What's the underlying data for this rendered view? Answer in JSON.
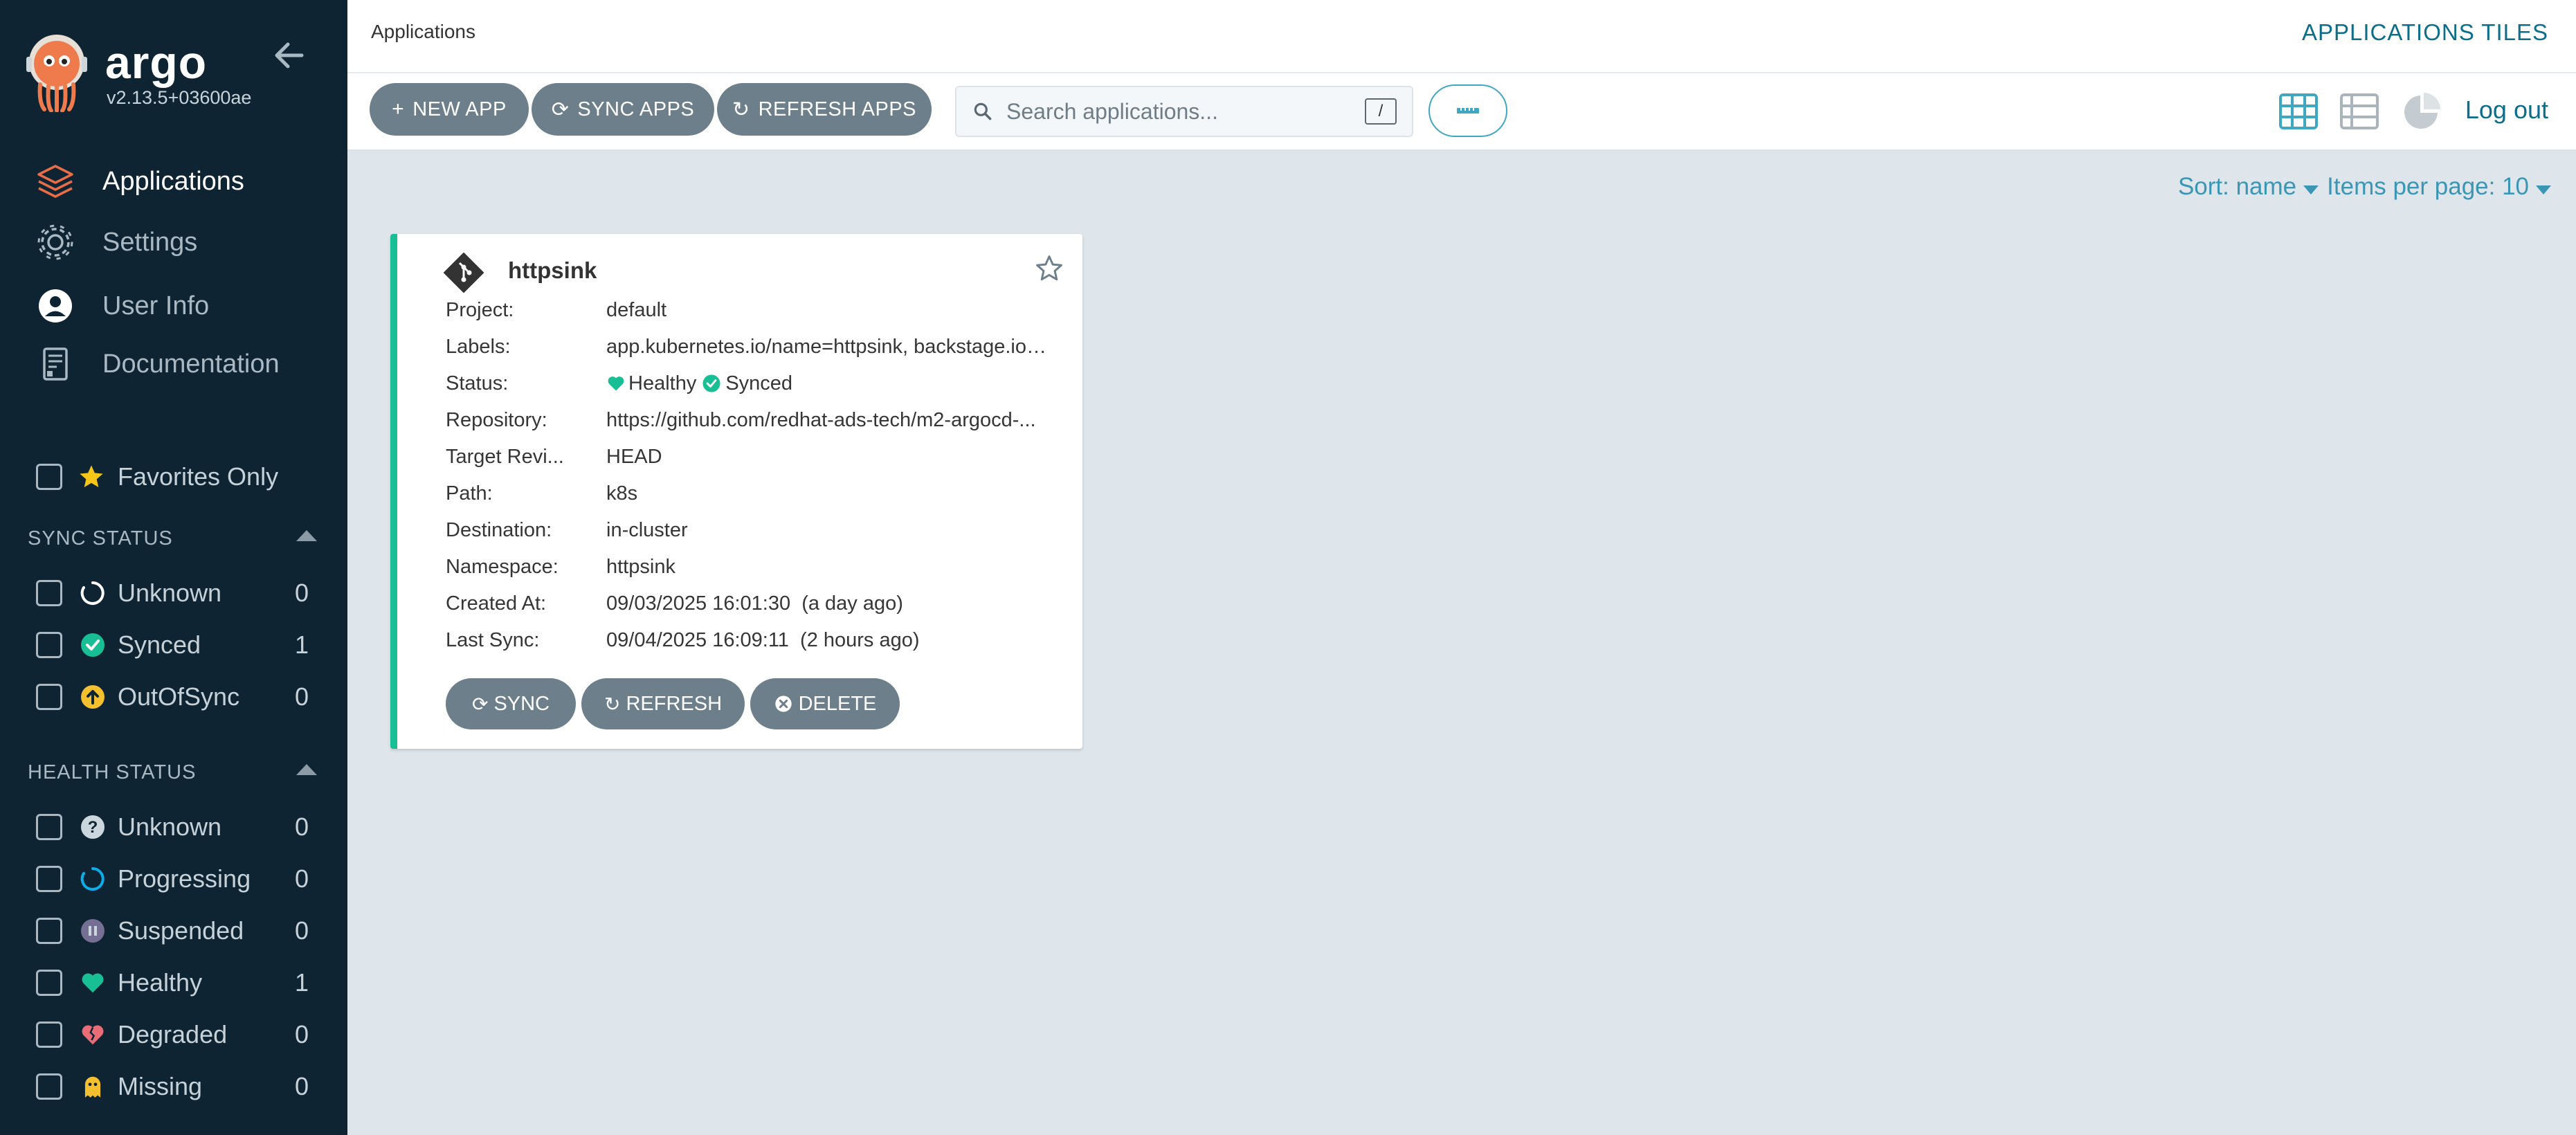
{
  "sidebar": {
    "brand": "argo",
    "version": "v2.13.5+03600ae",
    "nav": [
      {
        "label": "Applications",
        "icon": "layers-icon",
        "active": true
      },
      {
        "label": "Settings",
        "icon": "gear-icon"
      },
      {
        "label": "User Info",
        "icon": "user-icon"
      },
      {
        "label": "Documentation",
        "icon": "docs-icon"
      }
    ],
    "favorites_label": "Favorites Only",
    "sync_status": {
      "title": "SYNC STATUS",
      "items": [
        {
          "label": "Unknown",
          "count": "0"
        },
        {
          "label": "Synced",
          "count": "1"
        },
        {
          "label": "OutOfSync",
          "count": "0"
        }
      ]
    },
    "health_status": {
      "title": "HEALTH STATUS",
      "items": [
        {
          "label": "Unknown",
          "count": "0"
        },
        {
          "label": "Progressing",
          "count": "0"
        },
        {
          "label": "Suspended",
          "count": "0"
        },
        {
          "label": "Healthy",
          "count": "1"
        },
        {
          "label": "Degraded",
          "count": "0"
        },
        {
          "label": "Missing",
          "count": "0"
        }
      ]
    }
  },
  "header": {
    "breadcrumb": "Applications",
    "title": "APPLICATIONS TILES",
    "logout": "Log out"
  },
  "toolbar": {
    "new_app": "NEW APP",
    "sync_apps": "SYNC APPS",
    "refresh_apps": "REFRESH APPS",
    "search_placeholder": "Search applications...",
    "search_shortcut": "/"
  },
  "sort": {
    "sort_label": "Sort: name",
    "per_page_label": "Items per page: 10"
  },
  "app": {
    "name": "httpsink",
    "fields": [
      {
        "key": "Project:",
        "value": "default"
      },
      {
        "key": "Labels:",
        "value": "app.kubernetes.io/name=httpsink, backstage.io/kubernetes-id=httpsink"
      },
      {
        "key": "Status:",
        "value": ""
      },
      {
        "key": "Repository:",
        "value": "https://github.com/redhat-ads-tech/m2-argocd-..."
      },
      {
        "key": "Target Revi...",
        "value": "HEAD"
      },
      {
        "key": "Path:",
        "value": "k8s"
      },
      {
        "key": "Destination:",
        "value": "in-cluster"
      },
      {
        "key": "Namespace:",
        "value": "httpsink"
      },
      {
        "key": "Created At:",
        "value": "09/03/2025 16:01:30  (a day ago)"
      },
      {
        "key": "Last Sync:",
        "value": "09/04/2025 16:09:11  (2 hours ago)"
      }
    ],
    "health": "Healthy",
    "sync": "Synced",
    "buttons": {
      "sync": "SYNC",
      "refresh": "REFRESH",
      "delete": "DELETE"
    }
  },
  "colors": {
    "sidebar_bg": "#0e2432",
    "accent": "#0d6e8c",
    "healthy": "#18be94",
    "button_gray": "#6d7f8b"
  }
}
